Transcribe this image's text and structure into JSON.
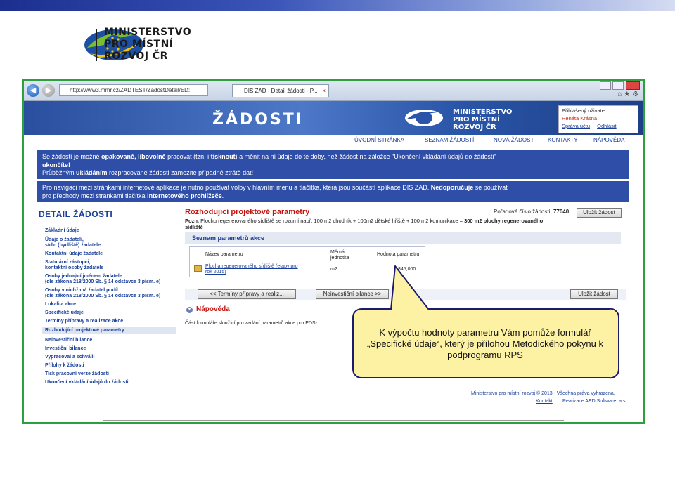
{
  "slide": {
    "org_logo": {
      "lines": [
        "MINISTERSTVO",
        "PRO MÍSTNÍ",
        "ROZVOJ ČR"
      ]
    },
    "frame_color": "#2e9e3e"
  },
  "browser": {
    "url": "http://www3.mmr.cz/ZADTEST/ZadostDetail/ED:",
    "tab_title": "DIS ZAD - Detail žádosti - P...",
    "tab_close": "×"
  },
  "app": {
    "title": "ŽÁDOSTI",
    "logo_lines": [
      "MINISTERSTVO",
      "PRO MÍSTNÍ",
      "ROZVOJ ČR"
    ],
    "user": {
      "title": "Přihlášený uživatel",
      "name": "Renáta Krásná",
      "account_link": "Správa účtu",
      "logout_link": "Odhlásit"
    },
    "menu": [
      "ÚVODNÍ STRÁNKA",
      "SEZNAM ŽÁDOSTÍ",
      "NOVÁ ŽÁDOST",
      "KONTAKTY",
      "NÁPOVĚDA"
    ],
    "info1": {
      "l1a": "Se žádostí je možné ",
      "l1b": "opakovaně, libovolně",
      "l1c": " pracovat (tzn. i ",
      "l1d": "tisknout",
      "l1e": ") a měnit na ní údaje do té doby, než žádost na záložce \"Ukončení vkládání údajů do žádosti\"",
      "l2": "ukončíte!",
      "l3a": "Průběžným ",
      "l3b": "ukládáním",
      "l3c": " rozpracované žádosti zamezíte případné ztrátě dat!"
    },
    "info2": {
      "l1a": "Pro navigaci mezi stránkami internetové aplikace je nutno používat volby v hlavním menu a tlačítka, která jsou součástí aplikace DIS ZAD. ",
      "l1b": "Nedoporučuje",
      "l1c": " se používat",
      "l2a": "pro přechody mezi stránkami tlačítka ",
      "l2b": "internetového prohlížeče",
      "l2c": "."
    },
    "sidebar": {
      "title": "DETAIL ŽÁDOSTI",
      "items": [
        "Základní údaje",
        "Údaje o žadateli,",
        "sídlo (bydliště) žadatele",
        "Kontaktní údaje žadatele",
        "Statutární zástupci,",
        "kontaktní osoby žadatele",
        "Osoby jednající jménem žadatele",
        "(dle zákona 218/2000 Sb. § 14 odstavce 3 písm. e)",
        "Osoby v nichž má žadatel podíl",
        "(dle zákona 218/2000 Sb. § 14 odstavce 3 písm. e)",
        "Lokalita akce",
        "Specifické údaje",
        "Termíny přípravy a realizace akce",
        "Rozhodující projektové parametry",
        "Neinvestiční bilance",
        "Investiční bilance",
        "Vypracoval a schválil",
        "Přílohy k žádosti",
        "Tisk pracovní verze žádosti",
        "Ukončení vkládání údajů do žádosti"
      ]
    },
    "content": {
      "title": "Rozhodující projektové parametry",
      "order_label": "Pořadové číslo žádosti:",
      "order_number": "77040",
      "save_button": "Uložit žádost",
      "note_bold": "Pozn.",
      "note_text": " Plochu regenerovaného sídliště se rozumí např. 100 m2 chodník + 100m2 dětské hřiště + 100 m2 komunikace = ",
      "note_bold2": "300 m2 plochy regenerovaného",
      "note_bold3": "sídliště",
      "section_title": "Seznam parametrů akce",
      "table_headers": {
        "name": "Název parametru",
        "unit_l1": "Měrná",
        "unit_l2": "jednotka",
        "value": "Hodnota parametru"
      },
      "row": {
        "name_l1": "Plocha regenerovaného sídliště (etapy pro",
        "name_l2": "rok 2015)",
        "unit": "m2",
        "value": "845,000"
      },
      "prev_button": "<<  Termíny přípravy a realiz...",
      "next_button": "Neinvestiční bilance  >>",
      "save_button2": "Uložit žádost",
      "help_title": "Nápověda",
      "help_text": "Část formuláře sloužící pro zadání parametrů akce pro EDS-"
    },
    "footer": {
      "line1": "Ministerstvo pro místní rozvoj © 2013 - Všechna práva vyhrazena.",
      "contact": "Kontakt",
      "realization": "Realizace AED Software, a.s."
    }
  },
  "callout": {
    "line1": "K výpočtu hodnoty parametru Vám pomůže formulář",
    "line2": "„Specifické údaje“, který je přílohou Metodického pokynu k",
    "line3": "podprogramu RPS"
  }
}
